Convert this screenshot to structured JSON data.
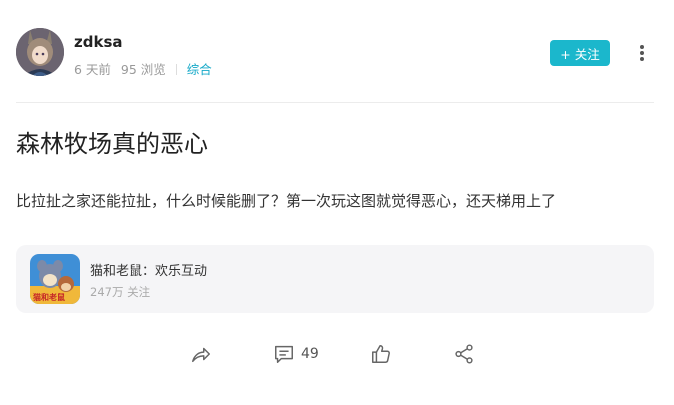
{
  "author": {
    "name": "zdksa",
    "time": "6 天前",
    "views": "95 浏览",
    "category": "综合"
  },
  "follow_label": "+ 关注",
  "post": {
    "title": "森林牧场真的恶心",
    "body": "比拉扯之家还能拉扯，什么时候能删了？第一次玩这图就觉得恶心，还天梯用上了"
  },
  "game": {
    "name": "猫和老鼠：欢乐互动",
    "followers": "247万 关注",
    "icon_logo_text": "猫和老鼠"
  },
  "actions": {
    "share_icon": "share-arrow-icon",
    "comment_icon": "comment-icon",
    "comment_count": "49",
    "like_icon": "thumbs-up-icon",
    "forward_icon": "share-nodes-icon"
  },
  "colors": {
    "accent": "#1bb7cc",
    "category": "#16a9c8",
    "card_bg": "#f5f5f7"
  }
}
